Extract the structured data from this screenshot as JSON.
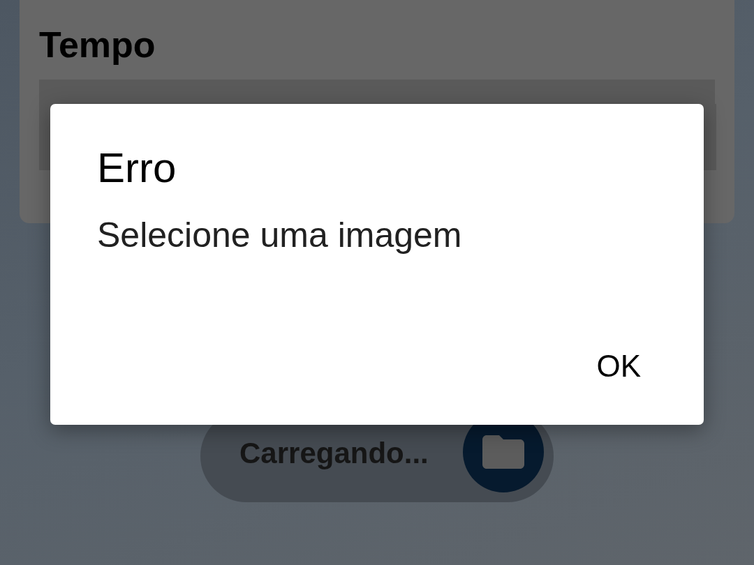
{
  "background_card": {
    "title": "Tempo"
  },
  "loading_button": {
    "label": "Carregando..."
  },
  "dialog": {
    "title": "Erro",
    "message": "Selecione uma imagem",
    "buttons": [
      "OK"
    ]
  }
}
